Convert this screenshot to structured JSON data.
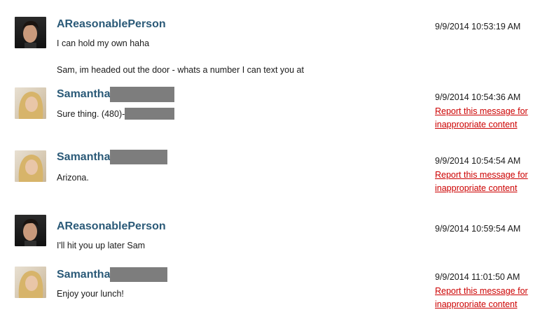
{
  "messages": [
    {
      "sender": "AReasonablePerson",
      "timestamp": "9/9/2014 10:53:19 AM",
      "lines": [
        "I can hold my own haha",
        "Sam, im headed out the door - whats a number I can text you at"
      ],
      "avatar": "male-avatar"
    },
    {
      "sender": "Samantha",
      "timestamp": "9/9/2014 10:54:36 AM",
      "lines": [
        "Sure thing. (480)-"
      ],
      "report": "Report this message for inappropriate content",
      "avatar": "female-avatar"
    },
    {
      "sender": "Samantha",
      "timestamp": "9/9/2014 10:54:54 AM",
      "lines": [
        "Arizona."
      ],
      "report": "Report this message for inappropriate content",
      "avatar": "female-avatar"
    },
    {
      "sender": "AReasonablePerson",
      "timestamp": "9/9/2014 10:59:54 AM",
      "lines": [
        "I'll hit you up later Sam"
      ],
      "avatar": "male-avatar"
    },
    {
      "sender": "Samantha",
      "timestamp": "9/9/2014 11:01:50 AM",
      "lines": [
        "Enjoy your lunch!"
      ],
      "report": "Report this message for inappropriate content",
      "avatar": "female-avatar"
    }
  ],
  "colors": {
    "name": "#2b5a78",
    "report_link": "#cc0000",
    "redaction": "#7d7d7d"
  }
}
